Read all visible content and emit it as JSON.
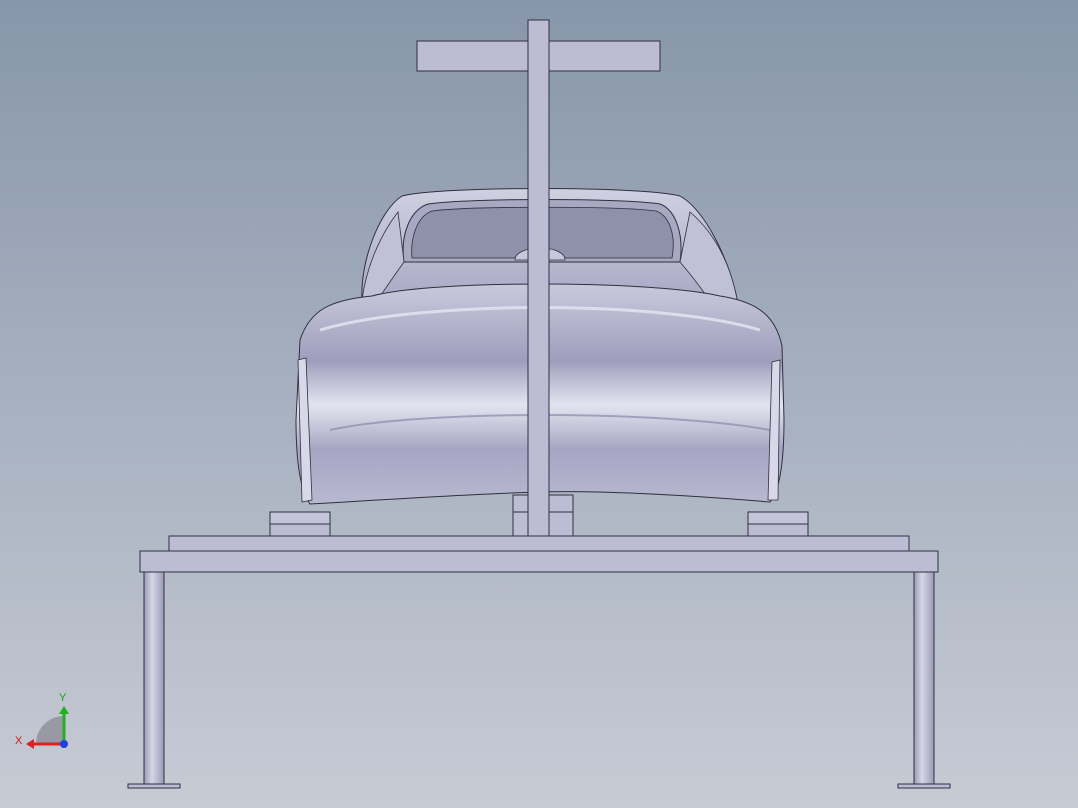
{
  "viewport": {
    "background_top": "#8796aa",
    "background_bottom": "#c7cbd4"
  },
  "model": {
    "body_color": "#b9b9d2",
    "edge_color": "#2f2f3f",
    "frame_color": "#bcbcd4"
  },
  "triad": {
    "x_label": "X",
    "y_label": "Y",
    "x_color": "#e02020",
    "y_color": "#20b020",
    "z_color": "#2040e0"
  }
}
